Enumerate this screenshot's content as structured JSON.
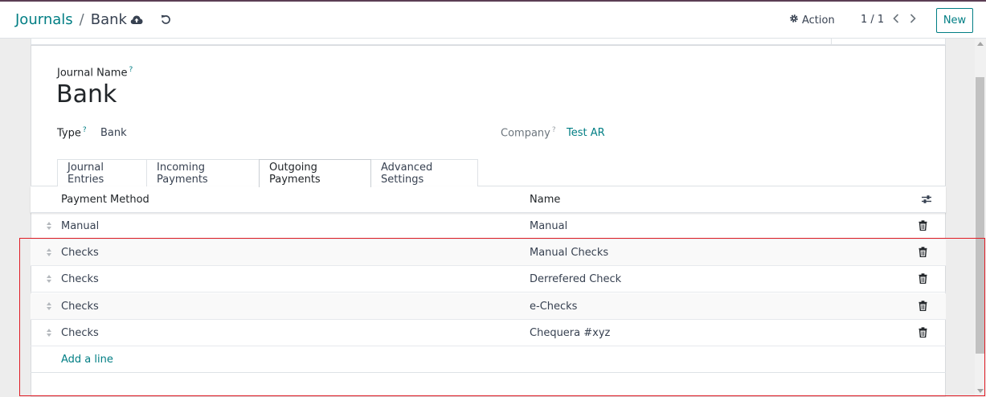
{
  "breadcrumb": {
    "parent": "Journals",
    "separator": "/",
    "current": "Bank"
  },
  "control_panel": {
    "action_label": "Action",
    "pager": "1 / 1",
    "new_label": "New"
  },
  "form": {
    "journal_name_label": "Journal Name",
    "help_marker": "?",
    "journal_name": "Bank",
    "type_label": "Type",
    "type_value": "Bank",
    "company_label": "Company",
    "company_value": "Test AR"
  },
  "tabs": [
    {
      "label": "Journal Entries"
    },
    {
      "label": "Incoming Payments"
    },
    {
      "label": "Outgoing Payments",
      "active": true
    },
    {
      "label": "Advanced Settings"
    }
  ],
  "table": {
    "columns": [
      "Payment Method",
      "Name"
    ],
    "rows": [
      {
        "payment_method": "Manual",
        "name": "Manual"
      },
      {
        "payment_method": "Checks",
        "name": "Manual Checks"
      },
      {
        "payment_method": "Checks",
        "name": "Derrefered Check"
      },
      {
        "payment_method": "Checks",
        "name": "e-Checks"
      },
      {
        "payment_method": "Checks",
        "name": "Chequera #xyz"
      }
    ],
    "add_line": "Add a line"
  },
  "colors": {
    "accent": "#017e84",
    "annotation": "#e01b24",
    "brand_bar": "#5b3e54"
  }
}
